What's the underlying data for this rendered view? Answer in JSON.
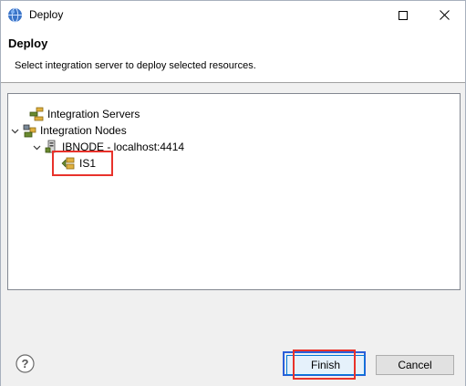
{
  "window": {
    "title": "Deploy"
  },
  "header": {
    "title": "Deploy",
    "description": "Select integration server to deploy selected resources."
  },
  "tree": {
    "items": [
      {
        "label": "Integration Servers",
        "icon": "integration-servers-icon"
      },
      {
        "label": "Integration Nodes",
        "icon": "integration-nodes-icon",
        "expanded": true
      },
      {
        "label": "IBNODE - localhost:4414",
        "icon": "node-icon",
        "expanded": true
      },
      {
        "label": "IS1",
        "icon": "integration-server-icon",
        "selected": true
      }
    ]
  },
  "buttons": {
    "finish": "Finish",
    "cancel": "Cancel"
  },
  "colors": {
    "highlight": "#e8322b",
    "focus": "#2b5fd9"
  }
}
